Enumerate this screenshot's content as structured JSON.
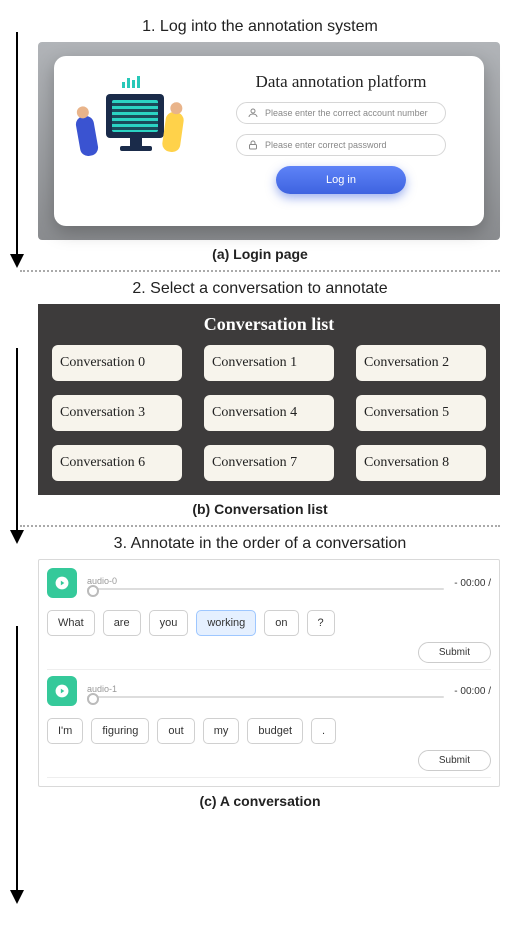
{
  "sectionA": {
    "step_title": "1. Log into the annotation system",
    "caption": "(a) Login page",
    "title": "Data annotation platform",
    "account_placeholder": "Please enter the correct account number",
    "password_placeholder": "Please enter correct password",
    "login_label": "Log in"
  },
  "sectionB": {
    "step_title": "2. Select a conversation to annotate",
    "caption": "(b) Conversation list",
    "title": "Conversation list",
    "items": [
      "Conversation 0",
      "Conversation 1",
      "Conversation 2",
      "Conversation 3",
      "Conversation 4",
      "Conversation 5",
      "Conversation 6",
      "Conversation 7",
      "Conversation 8"
    ]
  },
  "sectionC": {
    "step_title": "3. Annotate in the order of a conversation",
    "caption": "(c) A conversation",
    "segments": [
      {
        "audio_label": "audio-0",
        "time": "- 00:00 /",
        "tokens": [
          "What",
          "are",
          "you",
          "working",
          "on",
          "?"
        ],
        "highlighted_index": 3,
        "submit_label": "Submit"
      },
      {
        "audio_label": "audio-1",
        "time": "- 00:00 /",
        "tokens": [
          "I'm",
          "figuring",
          "out",
          "my",
          "budget",
          "."
        ],
        "highlighted_index": -1,
        "submit_label": "Submit"
      }
    ]
  }
}
